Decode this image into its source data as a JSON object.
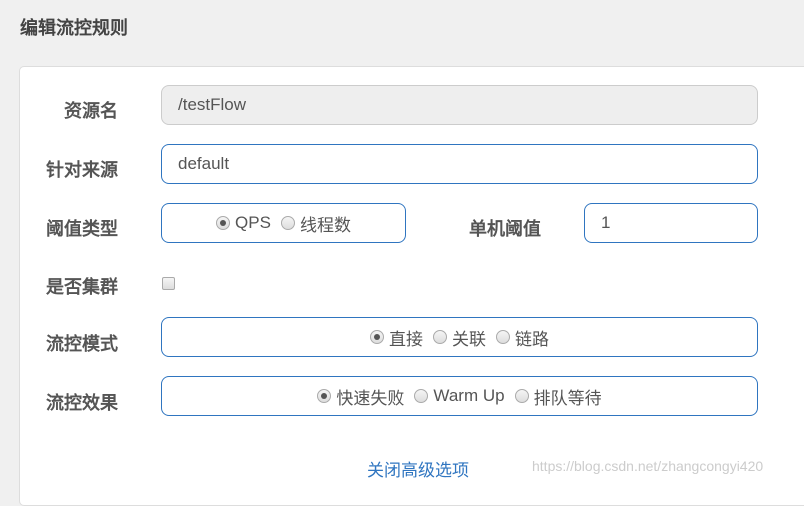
{
  "title": "编辑流控规则",
  "fields": {
    "resource": {
      "label": "资源名",
      "value": "/testFlow"
    },
    "limitApp": {
      "label": "针对来源",
      "value": "default"
    },
    "grade": {
      "label": "阈值类型",
      "options": [
        "QPS",
        "线程数"
      ],
      "selected": 0
    },
    "count": {
      "label": "单机阈值",
      "value": "1"
    },
    "cluster": {
      "label": "是否集群",
      "checked": false
    },
    "strategy": {
      "label": "流控模式",
      "options": [
        "直接",
        "关联",
        "链路"
      ],
      "selected": 0
    },
    "behavior": {
      "label": "流控效果",
      "options": [
        "快速失败",
        "Warm Up",
        "排队等待"
      ],
      "selected": 0
    }
  },
  "advanced_link": "关闭高级选项",
  "watermark": "https://blog.csdn.net/zhangcongyi420"
}
